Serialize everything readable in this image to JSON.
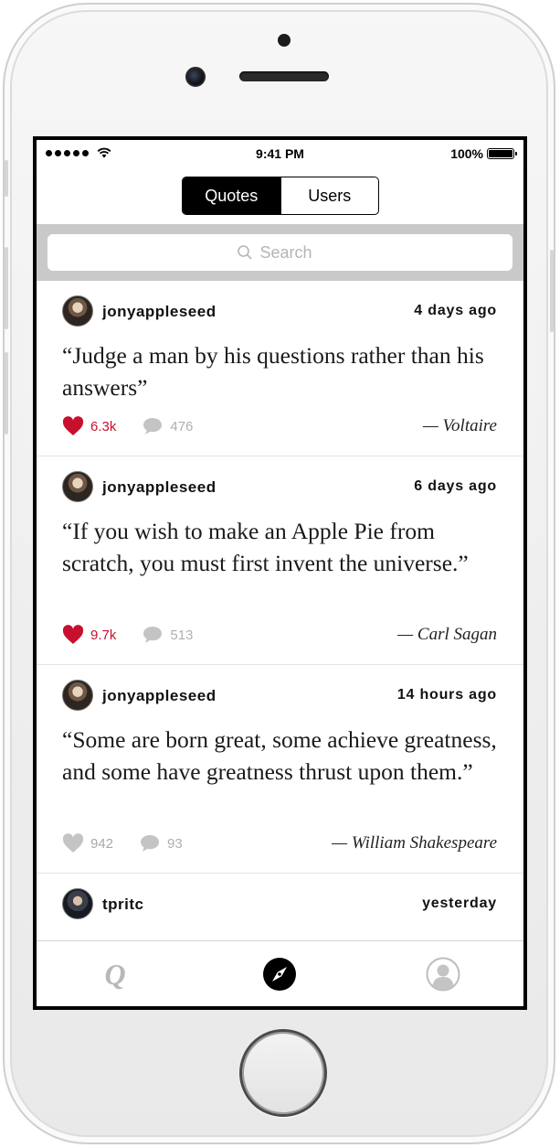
{
  "status_bar": {
    "time": "9:41 PM",
    "battery": "100%",
    "battery_level": 1.0
  },
  "segment": {
    "quotes_label": "Quotes",
    "users_label": "Users",
    "selected": "Quotes"
  },
  "search": {
    "placeholder": "Search"
  },
  "feed": [
    {
      "user": "jonyappleseed",
      "time": "4 days ago",
      "quote": "“Judge a man by his questions rather than his answers”",
      "likes": "6.3k",
      "liked": true,
      "comments": "476",
      "author": "— Voltaire"
    },
    {
      "user": "jonyappleseed",
      "time": "6 days ago",
      "quote": "“If you wish to make an Apple Pie from scratch, you must first invent the universe.”",
      "likes": "9.7k",
      "liked": true,
      "comments": "513",
      "author": "— Carl Sagan"
    },
    {
      "user": "jonyappleseed",
      "time": "14 hours ago",
      "quote": "“Some are born great, some achieve greatness, and some have greatness thrust upon them.”",
      "likes": "942",
      "liked": false,
      "comments": "93",
      "author": "— William Shakespeare"
    },
    {
      "user": "tpritc",
      "time": "yesterday"
    }
  ],
  "tab_bar": {
    "quotes_tab_glyph": "Q",
    "active_tab": "explore"
  },
  "colors": {
    "liked": "#c8102e",
    "muted": "#a8a8a8",
    "accent": "#000000",
    "search_bg": "#c9c9c9"
  },
  "icons": [
    "signal-icon",
    "wifi-icon",
    "battery-icon",
    "search-icon",
    "heart-icon",
    "comment-icon",
    "compass-icon",
    "profile-icon"
  ]
}
